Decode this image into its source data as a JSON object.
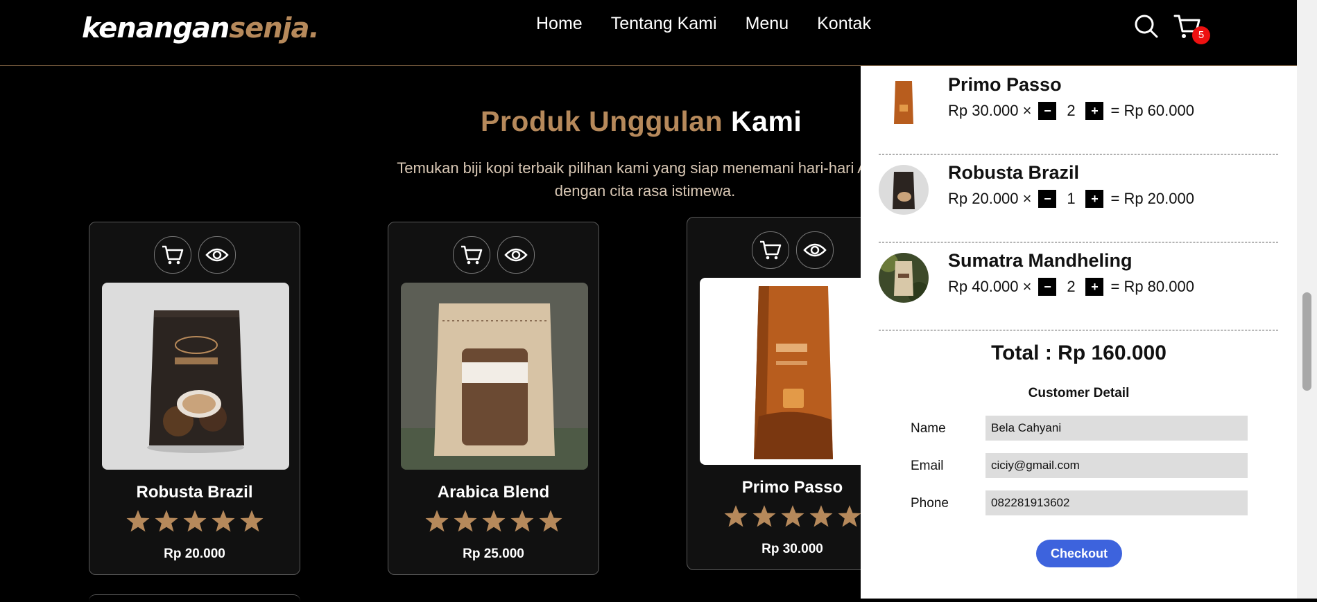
{
  "brand": {
    "logo_main": "kenangan",
    "logo_accent": "senja."
  },
  "nav": {
    "items": [
      "Home",
      "Tentang Kami",
      "Menu",
      "Kontak"
    ]
  },
  "header_icons": {
    "search": "search-icon",
    "cart": "shopping-cart-icon",
    "cart_count": "5"
  },
  "section": {
    "title_accent": "Produk Unggulan",
    "title_rest": " Kami",
    "subtitle": "Temukan biji kopi terbaik pilihan kami yang siap menemani hari-hari Anda dengan cita rasa istimewa."
  },
  "products": [
    {
      "name": "Robusta Brazil",
      "price": "Rp 20.000",
      "rating": 5
    },
    {
      "name": "Arabica Blend",
      "price": "Rp 25.000",
      "rating": 5
    },
    {
      "name": "Primo Passo",
      "price": "Rp 30.000",
      "rating": 5
    }
  ],
  "cart": {
    "items": [
      {
        "name": "Primo Passo",
        "unit_price": "Rp 30.000 ×",
        "qty": "2",
        "subtotal": "= Rp 60.000"
      },
      {
        "name": "Robusta Brazil",
        "unit_price": "Rp 20.000 ×",
        "qty": "1",
        "subtotal": "= Rp 20.000"
      },
      {
        "name": "Sumatra Mandheling",
        "unit_price": "Rp 40.000 ×",
        "qty": "2",
        "subtotal": "= Rp 80.000"
      }
    ],
    "minus": "−",
    "plus": "+",
    "total": "Total : Rp 160.000",
    "customer_detail_title": "Customer Detail",
    "fields": {
      "name_label": "Name",
      "name_value": "Bela Cahyani",
      "email_label": "Email",
      "email_value": "ciciy@gmail.com",
      "phone_label": "Phone",
      "phone_value": "082281913602"
    },
    "checkout_label": "Checkout"
  },
  "colors": {
    "accent": "#b6895b",
    "checkout": "#3d63dd",
    "badge": "#ee1111"
  }
}
